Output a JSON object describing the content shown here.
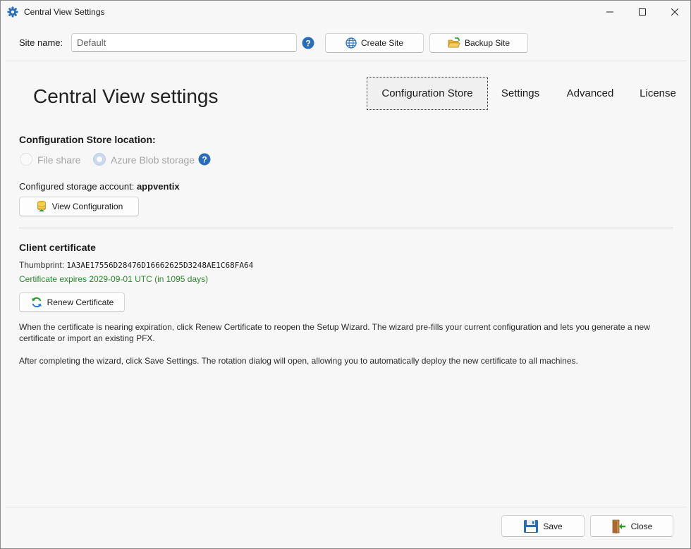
{
  "window": {
    "title": "Central View Settings",
    "icon": "gear-icon"
  },
  "site": {
    "label": "Site name:",
    "value": "Default",
    "create_label": "Create Site",
    "backup_label": "Backup Site"
  },
  "header": {
    "heading": "Central View settings"
  },
  "tabs": [
    {
      "label": "Configuration Store",
      "active": true
    },
    {
      "label": "Settings",
      "active": false
    },
    {
      "label": "Advanced",
      "active": false
    },
    {
      "label": "License",
      "active": false
    }
  ],
  "config_store": {
    "title": "Configuration Store location:",
    "option_file_share": "File share",
    "option_azure": "Azure Blob storage",
    "selected": "Azure Blob storage",
    "account_label": "Configured storage account:",
    "account_value": "appventix",
    "view_label": "View Configuration"
  },
  "certificate": {
    "title": "Client certificate",
    "thumb_label": "Thumbprint:",
    "thumb_value": "1A3AE17556D28476D16662625D3248AE1C68FA64",
    "expiry": "Certificate expires 2029-09-01 UTC (in 1095 days)",
    "renew_label": "Renew Certificate",
    "para1": "When the certificate is nearing expiration, click Renew Certificate to reopen the Setup Wizard. The wizard pre-fills your current configuration and lets you generate a new certificate or import an existing PFX.",
    "para2": "After completing the wizard, click Save Settings. The rotation dialog will open, allowing you to automatically deploy the new certificate to all machines."
  },
  "footer": {
    "save_label": "Save",
    "close_label": "Close"
  },
  "colors": {
    "accent": "#2b6cb8",
    "expiry_green": "#2a8a2a"
  }
}
